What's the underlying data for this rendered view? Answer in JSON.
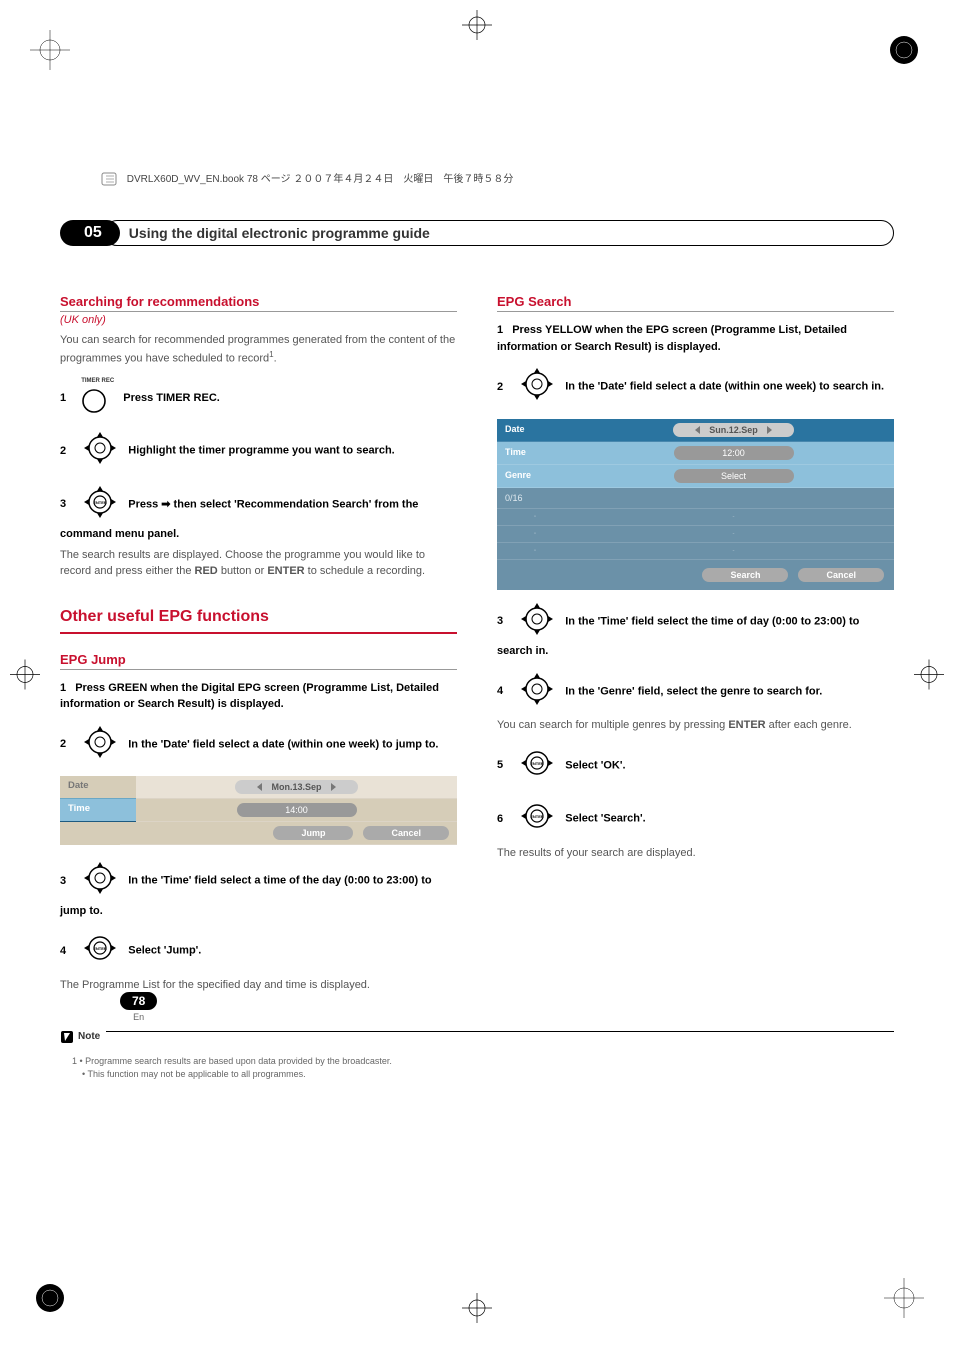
{
  "header": {
    "book_line": "DVRLX60D_WV_EN.book 78 ページ ２００７年４月２４日　火曜日　午後７時５８分"
  },
  "chapter": {
    "number": "05",
    "title": "Using the digital electronic programme guide"
  },
  "left": {
    "search_rec_title": "Searching for recommendations",
    "uk_only": "(UK only)",
    "intro": "You can search for recommended programmes generated from the content of the programmes you have scheduled to record",
    "intro_sup": "1",
    "step1": {
      "num": "1",
      "label": "TIMER REC",
      "text": "Press TIMER REC."
    },
    "step2": {
      "num": "2",
      "text": "Highlight the timer programme you want to search."
    },
    "step3": {
      "num": "3",
      "text_a": "Press ",
      "text_b": " then select 'Recommendation Search' from the command menu panel.",
      "desc": "The search results are displayed. Choose the programme you would like to record and press either the ",
      "desc_bold1": "RED",
      "desc_mid": " button or ",
      "desc_bold2": "ENTER",
      "desc_end": " to schedule a recording."
    },
    "other_title": "Other useful EPG functions",
    "epg_jump_title": "EPG Jump",
    "jump_step1": {
      "num": "1",
      "text": "Press GREEN when the Digital EPG screen (Programme List, Detailed information or Search Result) is displayed."
    },
    "jump_step2": {
      "num": "2",
      "text": "In the 'Date' field select a date (within one week) to jump to."
    },
    "jump_table": {
      "date_label": "Date",
      "date_val": "Mon.13.Sep",
      "time_label": "Time",
      "time_val": "14:00",
      "btn_jump": "Jump",
      "btn_cancel": "Cancel"
    },
    "jump_step3": {
      "num": "3",
      "text": "In the 'Time' field select a time of the day (0:00 to 23:00) to jump to."
    },
    "jump_step4": {
      "num": "4",
      "text": "Select 'Jump'.",
      "desc": "The Programme List for the specified day and time is displayed."
    }
  },
  "right": {
    "epg_search_title": "EPG Search",
    "s1": {
      "num": "1",
      "text": "Press YELLOW when the EPG screen (Programme List, Detailed information or Search Result) is displayed."
    },
    "s2": {
      "num": "2",
      "text": "In the 'Date' field select a date (within one week) to search in."
    },
    "search_table": {
      "date_label": "Date",
      "date_val": "Sun.12.Sep",
      "time_label": "Time",
      "time_val": "12:00",
      "genre_label": "Genre",
      "genre_val": "Select",
      "count": "0/16",
      "btn_search": "Search",
      "btn_cancel": "Cancel"
    },
    "s3": {
      "num": "3",
      "text": "In the 'Time' field select the time of day (0:00 to 23:00) to search in."
    },
    "s4": {
      "num": "4",
      "text": "In the 'Genre' field, select the genre to search for.",
      "desc_a": "You can search for multiple genres by pressing ",
      "desc_bold": "ENTER",
      "desc_b": " after each genre."
    },
    "s5": {
      "num": "5",
      "text": "Select 'OK'."
    },
    "s6": {
      "num": "6",
      "text": "Select 'Search'.",
      "desc": "The results of your search are displayed."
    }
  },
  "note": {
    "label": "Note",
    "line1": "1 • Programme search results are based upon data provided by the broadcaster.",
    "line2": "• This function may not be applicable to all programmes."
  },
  "page": {
    "number": "78",
    "lang": "En"
  }
}
